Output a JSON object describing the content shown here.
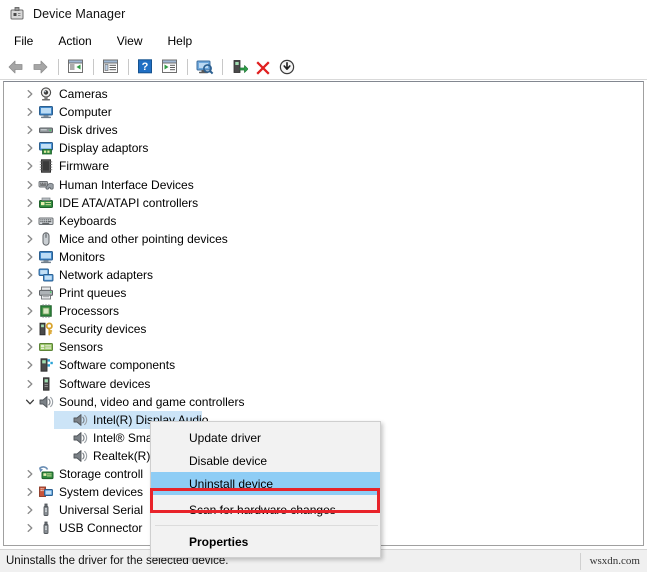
{
  "window": {
    "title": "Device Manager",
    "title_icon": "device-manager-icon"
  },
  "menubar": {
    "items": [
      {
        "label": "File"
      },
      {
        "label": "Action"
      },
      {
        "label": "View"
      },
      {
        "label": "Help"
      }
    ]
  },
  "toolbar": {
    "buttons": [
      {
        "name": "back-button",
        "icon": "back-arrow-icon",
        "label": "Back"
      },
      {
        "name": "forward-button",
        "icon": "forward-arrow-icon",
        "label": "Forward"
      },
      {
        "name": "show-hide-console-tree-button",
        "icon": "console-tree-icon",
        "label": "Show/Hide Console Tree"
      },
      {
        "name": "properties-button",
        "icon": "properties-window-icon",
        "label": "Properties"
      },
      {
        "name": "help-button",
        "icon": "help-question-icon",
        "label": "Help"
      },
      {
        "name": "show-hide-action-pane-button",
        "icon": "action-pane-icon",
        "label": "Show/Hide Action Pane"
      },
      {
        "name": "scan-for-hardware-changes-button",
        "icon": "scan-monitor-icon",
        "label": "Scan for hardware changes"
      },
      {
        "name": "update-driver-button",
        "icon": "update-driver-icon",
        "label": "Update driver"
      },
      {
        "name": "uninstall-device-button",
        "icon": "red-x-icon",
        "label": "Uninstall device"
      },
      {
        "name": "disable-device-button",
        "icon": "down-arrow-circle-icon",
        "label": "Disable device"
      }
    ]
  },
  "tree": {
    "nodes": [
      {
        "label": "Cameras",
        "icon": "camera-icon",
        "level": 1,
        "expanded": false,
        "selected": false
      },
      {
        "label": "Computer",
        "icon": "computer-monitor-icon",
        "level": 1,
        "expanded": false,
        "selected": false
      },
      {
        "label": "Disk drives",
        "icon": "disk-drive-icon",
        "level": 1,
        "expanded": false,
        "selected": false
      },
      {
        "label": "Display adaptors",
        "icon": "display-adapter-icon",
        "level": 1,
        "expanded": false,
        "selected": false
      },
      {
        "label": "Firmware",
        "icon": "firmware-chip-icon",
        "level": 1,
        "expanded": false,
        "selected": false
      },
      {
        "label": "Human Interface Devices",
        "icon": "hid-icon",
        "level": 1,
        "expanded": false,
        "selected": false
      },
      {
        "label": "IDE ATA/ATAPI controllers",
        "icon": "ide-controller-icon",
        "level": 1,
        "expanded": false,
        "selected": false
      },
      {
        "label": "Keyboards",
        "icon": "keyboard-icon",
        "level": 1,
        "expanded": false,
        "selected": false
      },
      {
        "label": "Mice and other pointing devices",
        "icon": "mouse-icon",
        "level": 1,
        "expanded": false,
        "selected": false
      },
      {
        "label": "Monitors",
        "icon": "monitor-icon",
        "level": 1,
        "expanded": false,
        "selected": false
      },
      {
        "label": "Network adapters",
        "icon": "network-adapter-icon",
        "level": 1,
        "expanded": false,
        "selected": false
      },
      {
        "label": "Print queues",
        "icon": "printer-icon",
        "level": 1,
        "expanded": false,
        "selected": false
      },
      {
        "label": "Processors",
        "icon": "processor-icon",
        "level": 1,
        "expanded": false,
        "selected": false
      },
      {
        "label": "Security devices",
        "icon": "security-key-icon",
        "level": 1,
        "expanded": false,
        "selected": false
      },
      {
        "label": "Sensors",
        "icon": "sensor-icon",
        "level": 1,
        "expanded": false,
        "selected": false
      },
      {
        "label": "Software components",
        "icon": "software-component-icon",
        "level": 1,
        "expanded": false,
        "selected": false
      },
      {
        "label": "Software devices",
        "icon": "software-device-icon",
        "level": 1,
        "expanded": false,
        "selected": false
      },
      {
        "label": "Sound, video and game controllers",
        "icon": "speaker-icon",
        "level": 1,
        "expanded": true,
        "selected": false
      },
      {
        "label": "Intel(R) Display Audio",
        "icon": "speaker-icon",
        "level": 2,
        "expanded": null,
        "selected": true
      },
      {
        "label": "Intel® Smar",
        "icon": "speaker-icon",
        "level": 2,
        "expanded": null,
        "selected": false,
        "truncated": true
      },
      {
        "label": "Realtek(R) A",
        "icon": "speaker-icon",
        "level": 2,
        "expanded": null,
        "selected": false,
        "truncated": true
      },
      {
        "label": "Storage controll",
        "icon": "storage-controller-icon",
        "level": 1,
        "expanded": false,
        "selected": false,
        "truncated": true
      },
      {
        "label": "System devices",
        "icon": "system-device-icon",
        "level": 1,
        "expanded": false,
        "selected": false
      },
      {
        "label": "Universal Serial ",
        "icon": "usb-icon",
        "level": 1,
        "expanded": false,
        "selected": false,
        "truncated": true
      },
      {
        "label": "USB Connector ",
        "icon": "usb-icon",
        "level": 1,
        "expanded": false,
        "selected": false,
        "truncated": true
      }
    ]
  },
  "context_menu": {
    "items": [
      {
        "label": "Update driver",
        "highlighted": false,
        "bold": false
      },
      {
        "label": "Disable device",
        "highlighted": false,
        "bold": false
      },
      {
        "label": "Uninstall device",
        "highlighted": true,
        "bold": false
      },
      {
        "label": "Scan for hardware changes",
        "highlighted": false,
        "bold": false
      },
      {
        "label": "Properties",
        "highlighted": false,
        "bold": true
      }
    ]
  },
  "annotation": {
    "highlight_color": "#e8232a",
    "target": "Uninstall device"
  },
  "statusbar": {
    "message": "Uninstalls the driver for the selected device.",
    "watermark": "wsxdn.com"
  }
}
